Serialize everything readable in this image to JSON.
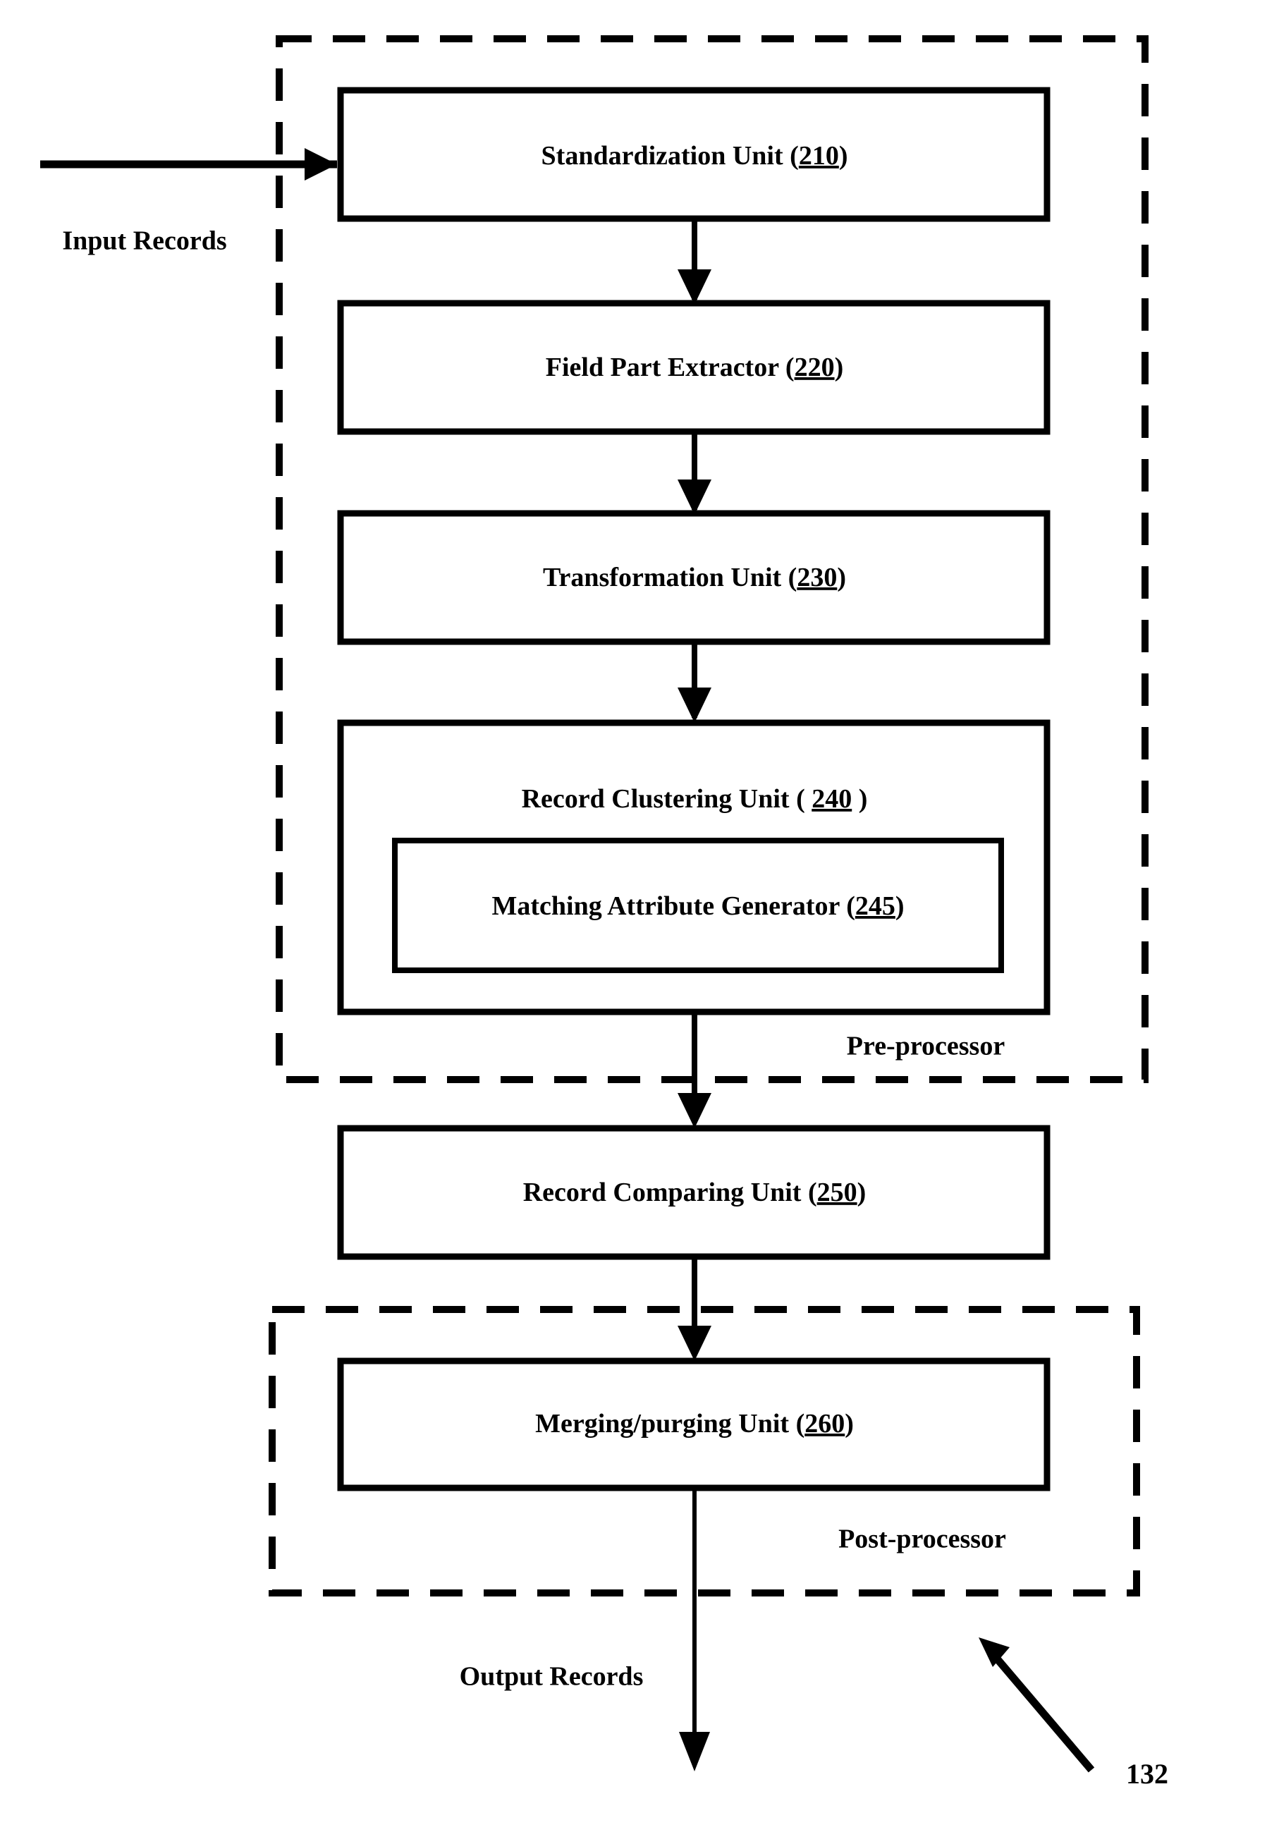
{
  "figure": {
    "reference_numeral": "132",
    "input_label": "Input Records",
    "output_label": "Output Records"
  },
  "groups": [
    {
      "id": "pre-processor",
      "label": "Pre-processor",
      "style": "dashed"
    },
    {
      "id": "post-processor",
      "label": "Post-processor",
      "style": "dashed"
    }
  ],
  "units": [
    {
      "id": "standardization-unit",
      "name": "Standardization Unit",
      "ref": "210",
      "open_paren": "(",
      "close_paren": ")",
      "group": "pre-processor"
    },
    {
      "id": "field-part-extractor",
      "name": "Field Part Extractor",
      "ref": "220",
      "open_paren": "(",
      "close_paren": ")",
      "group": "pre-processor"
    },
    {
      "id": "transformation-unit",
      "name": "Transformation Unit",
      "ref": "230",
      "open_paren": "(",
      "close_paren": ")",
      "group": "pre-processor"
    },
    {
      "id": "record-clustering-unit",
      "name": "Record Clustering Unit",
      "ref": "240",
      "open_paren": "( ",
      "close_paren": " )",
      "group": "pre-processor"
    },
    {
      "id": "matching-attribute-generator",
      "name": "Matching Attribute Generator",
      "ref": "245",
      "open_paren": "(",
      "close_paren": ")",
      "group": "pre-processor",
      "nested_in": "record-clustering-unit"
    },
    {
      "id": "record-comparing-unit",
      "name": "Record Comparing Unit",
      "ref": "250",
      "open_paren": "(",
      "close_paren": ")",
      "group": null
    },
    {
      "id": "merging-purging-unit",
      "name": "Merging/purging Unit",
      "ref": "260",
      "open_paren": "(",
      "close_paren": ")",
      "group": "post-processor"
    }
  ],
  "flow": {
    "edges": [
      {
        "from": "input",
        "to": "standardization-unit"
      },
      {
        "from": "standardization-unit",
        "to": "field-part-extractor"
      },
      {
        "from": "field-part-extractor",
        "to": "transformation-unit"
      },
      {
        "from": "transformation-unit",
        "to": "record-clustering-unit"
      },
      {
        "from": "record-clustering-unit",
        "to": "record-comparing-unit"
      },
      {
        "from": "record-comparing-unit",
        "to": "merging-purging-unit"
      },
      {
        "from": "merging-purging-unit",
        "to": "output"
      }
    ]
  },
  "colors": {
    "stroke": "#000000",
    "fill": "#ffffff",
    "background": "#ffffff"
  }
}
